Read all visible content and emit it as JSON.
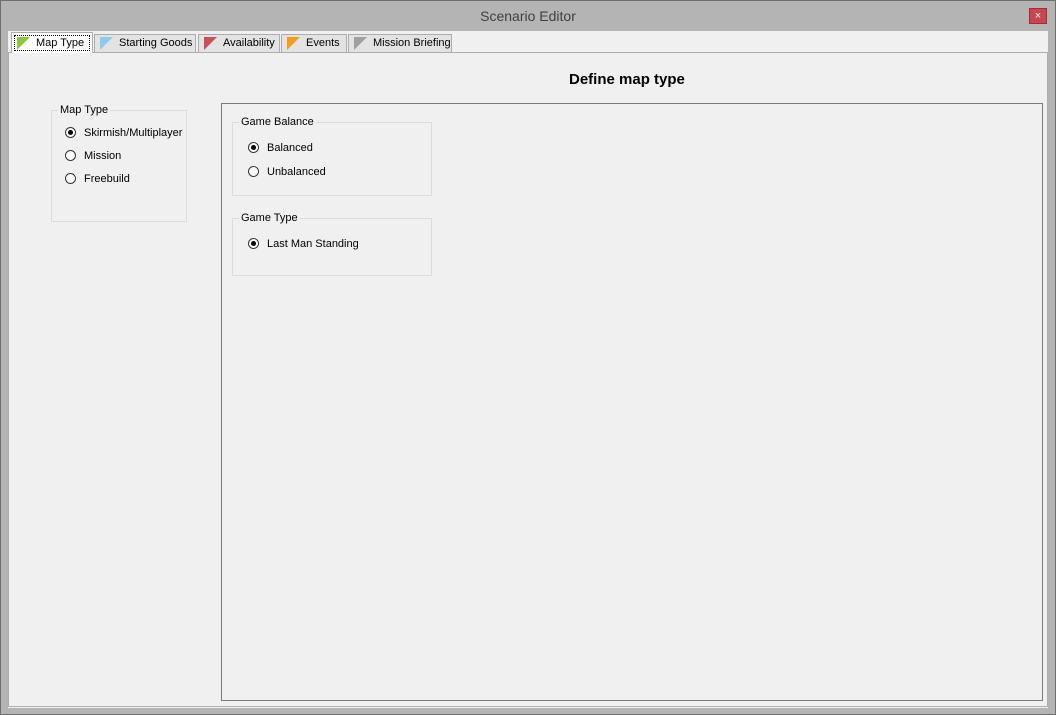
{
  "window": {
    "title": "Scenario Editor",
    "close_label": "×"
  },
  "tabs": [
    {
      "label": "Map Type",
      "flag_color": "#8cc63e",
      "active": true
    },
    {
      "label": "Starting Goods",
      "flag_color": "#8ccbea",
      "active": false
    },
    {
      "label": "Availability",
      "flag_color": "#c8505a",
      "active": false
    },
    {
      "label": "Events",
      "flag_color": "#f39c1e",
      "active": false
    },
    {
      "label": "Mission Briefing",
      "flag_color": "#a0a0a0",
      "active": false
    }
  ],
  "heading": "Define map type",
  "map_type_group": {
    "legend": "Map Type",
    "options": [
      {
        "label": "Skirmish/Multiplayer",
        "checked": true
      },
      {
        "label": "Mission",
        "checked": false
      },
      {
        "label": "Freebuild",
        "checked": false
      }
    ]
  },
  "game_balance_group": {
    "legend": "Game Balance",
    "options": [
      {
        "label": "Balanced",
        "checked": true
      },
      {
        "label": "Unbalanced",
        "checked": false
      }
    ]
  },
  "game_type_group": {
    "legend": "Game Type",
    "options": [
      {
        "label": "Last Man Standing",
        "checked": true
      }
    ]
  }
}
